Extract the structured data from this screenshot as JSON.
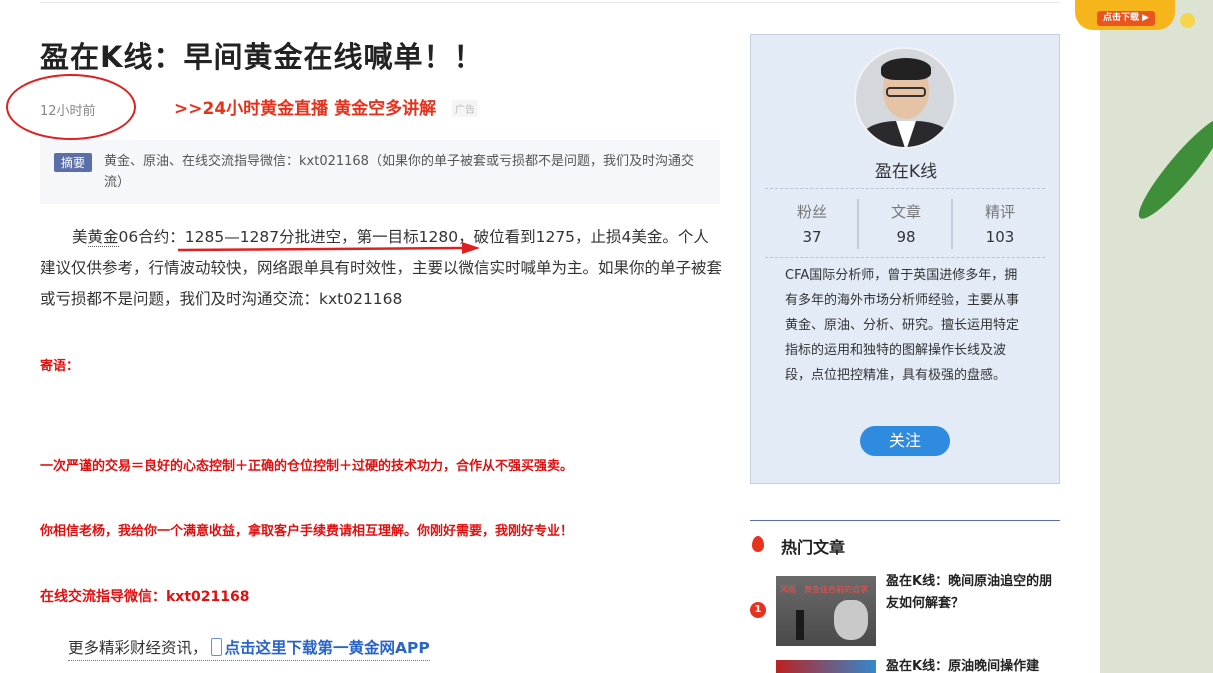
{
  "article": {
    "title": "盈在K线：早间黄金在线喊单！！",
    "time": "12小时前",
    "ad_link": ">>24小时黄金直播 黄金空多讲解",
    "ad_tag": "广告",
    "summary_tag": "摘要",
    "summary_text": "黄金、原油、在线交流指导微信：kxt021168（如果你的单子被套或亏损都不是问题，我们及时沟通交流）",
    "body_prefix": "美",
    "body_keyword": "黄金",
    "body_rest": "06合约：1285—1287分批进空，第一目标1280，破位看到1275，止损4美金。个人建议仅供参考，行情波动较快，网络跟单具有时效性，主要以微信实时喊单为主。如果你的单子被套或亏损都不是问题，我们及时沟通交流：kxt021168",
    "note_label": "寄语：",
    "note_1": "一次严谨的交易＝良好的心态控制＋正确的仓位控制＋过硬的技术功力，合作从不强买强卖。",
    "note_2": "你相信老杨，我给你一个满意收益，拿取客户手续费请相互理解。你刚好需要，我刚好专业！",
    "note_3": "在线交流指导微信：kxt021168",
    "app_prefix": "更多精彩财经资讯，",
    "app_link": "点击这里下载第一黄金网APP"
  },
  "top_ad": {
    "label": "点击下载 ▶"
  },
  "author": {
    "name": "盈在K线",
    "stats": [
      {
        "label": "粉丝",
        "value": "37"
      },
      {
        "label": "文章",
        "value": "98"
      },
      {
        "label": "精评",
        "value": "103"
      }
    ],
    "bio": "CFA国际分析师，曾于英国进修多年，拥有多年的海外市场分析师经验，主要从事黄金、原油、分析、研究。擅长运用特定指标的运用和独特的图解操作长线及波段，点位把控精准，具有极强的盘感。",
    "follow_label": "关注"
  },
  "hot": {
    "title": "热门文章",
    "items": [
      {
        "rank": "1",
        "title": "盈在K线：晚间原油追空的朋友如何解套？",
        "thumb_text": "风雨　黄金佳合前的追求"
      },
      {
        "title": "盈在K线：原油晚间操作建"
      }
    ]
  },
  "colors": {
    "accent_red": "#e01010",
    "link_blue": "#2a64c8",
    "follow_blue": "#2f8be0",
    "card_bg": "#e3ebf7"
  }
}
